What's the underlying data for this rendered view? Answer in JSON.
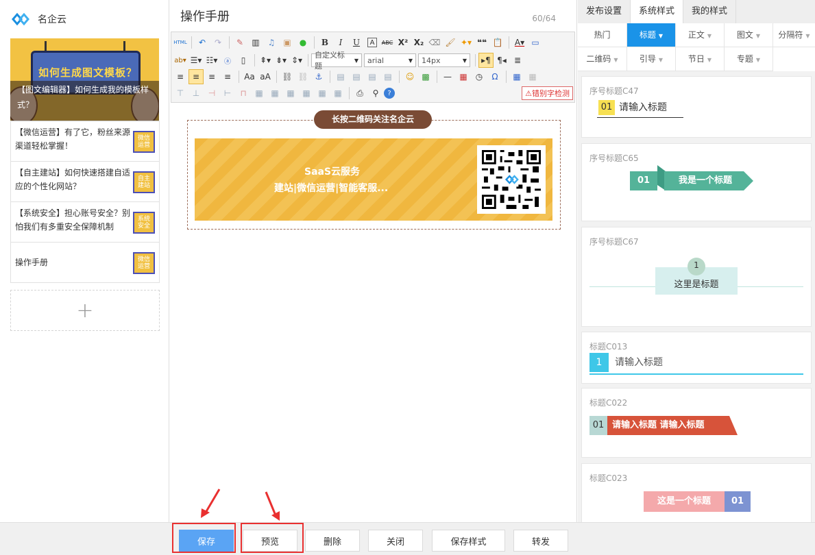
{
  "brand": {
    "name": "名企云"
  },
  "cover": {
    "board_text": "如何生成图文模板？",
    "caption": "【图文编辑器】如何生成我的模板样式？"
  },
  "articles": [
    {
      "title": "【微信运营】有了它，粉丝来源渠道轻松掌握！",
      "thumb": "微信运营"
    },
    {
      "title": "【自主建站】如何快速搭建自适应的个性化网站？",
      "thumb": "自主建站"
    },
    {
      "title": "【系统安全】担心账号安全？别怕我们有多重安全保障机制",
      "thumb": "系统安全"
    },
    {
      "title": "操作手册",
      "thumb": "微信运营"
    }
  ],
  "add_symbol": "+",
  "editor": {
    "title": "操作手册",
    "counter": "60/64",
    "toolbar": {
      "html_btn": "HTML",
      "bold": "B",
      "italic": "I",
      "underline": "U",
      "font_border": "A",
      "strike": "ABC",
      "sup": "X²",
      "sub": "X₂",
      "quote": "❝❝",
      "paragraph_select": "自定义标题",
      "font_select": "arial",
      "size_select": "14px",
      "spellcheck": "错别字检测"
    },
    "badge": "长按二维码关注名企云",
    "banner_line1": "SaaS云服务",
    "banner_line2": "建站|微信运营|智能客服..."
  },
  "right": {
    "tabs": [
      "发布设置",
      "系统样式",
      "我的样式"
    ],
    "active_tab": "系统样式",
    "categories_row1": [
      "热门",
      "标题",
      "正文",
      "图文",
      "分隔符"
    ],
    "categories_row2": [
      "二维码",
      "引导",
      "节日",
      "专题"
    ],
    "active_category": "标题",
    "styles": [
      {
        "name": "序号标题C47",
        "num": "01",
        "text": "请输入标题"
      },
      {
        "name": "序号标题C65",
        "num": "01",
        "text": "我是一个标题"
      },
      {
        "name": "序号标题C67",
        "num": "1",
        "text": "这里是标题"
      },
      {
        "name": "标题C013",
        "num": "1",
        "text": "请输入标题"
      },
      {
        "name": "标题C022",
        "num": "01",
        "text": "请输入标题 请输入标题"
      },
      {
        "name": "标题C023",
        "num": "01",
        "text": "这是一个标题"
      }
    ]
  },
  "bottom": {
    "save": "保存",
    "preview": "预览",
    "delete": "删除",
    "close": "关闭",
    "save_style": "保存样式",
    "forward": "转发"
  },
  "colors": {
    "accent": "#1a93e8",
    "save_btn": "#5aa4f4",
    "highlight": "#e93030",
    "banner": "#f0b73f",
    "badge": "#7a4b35"
  }
}
